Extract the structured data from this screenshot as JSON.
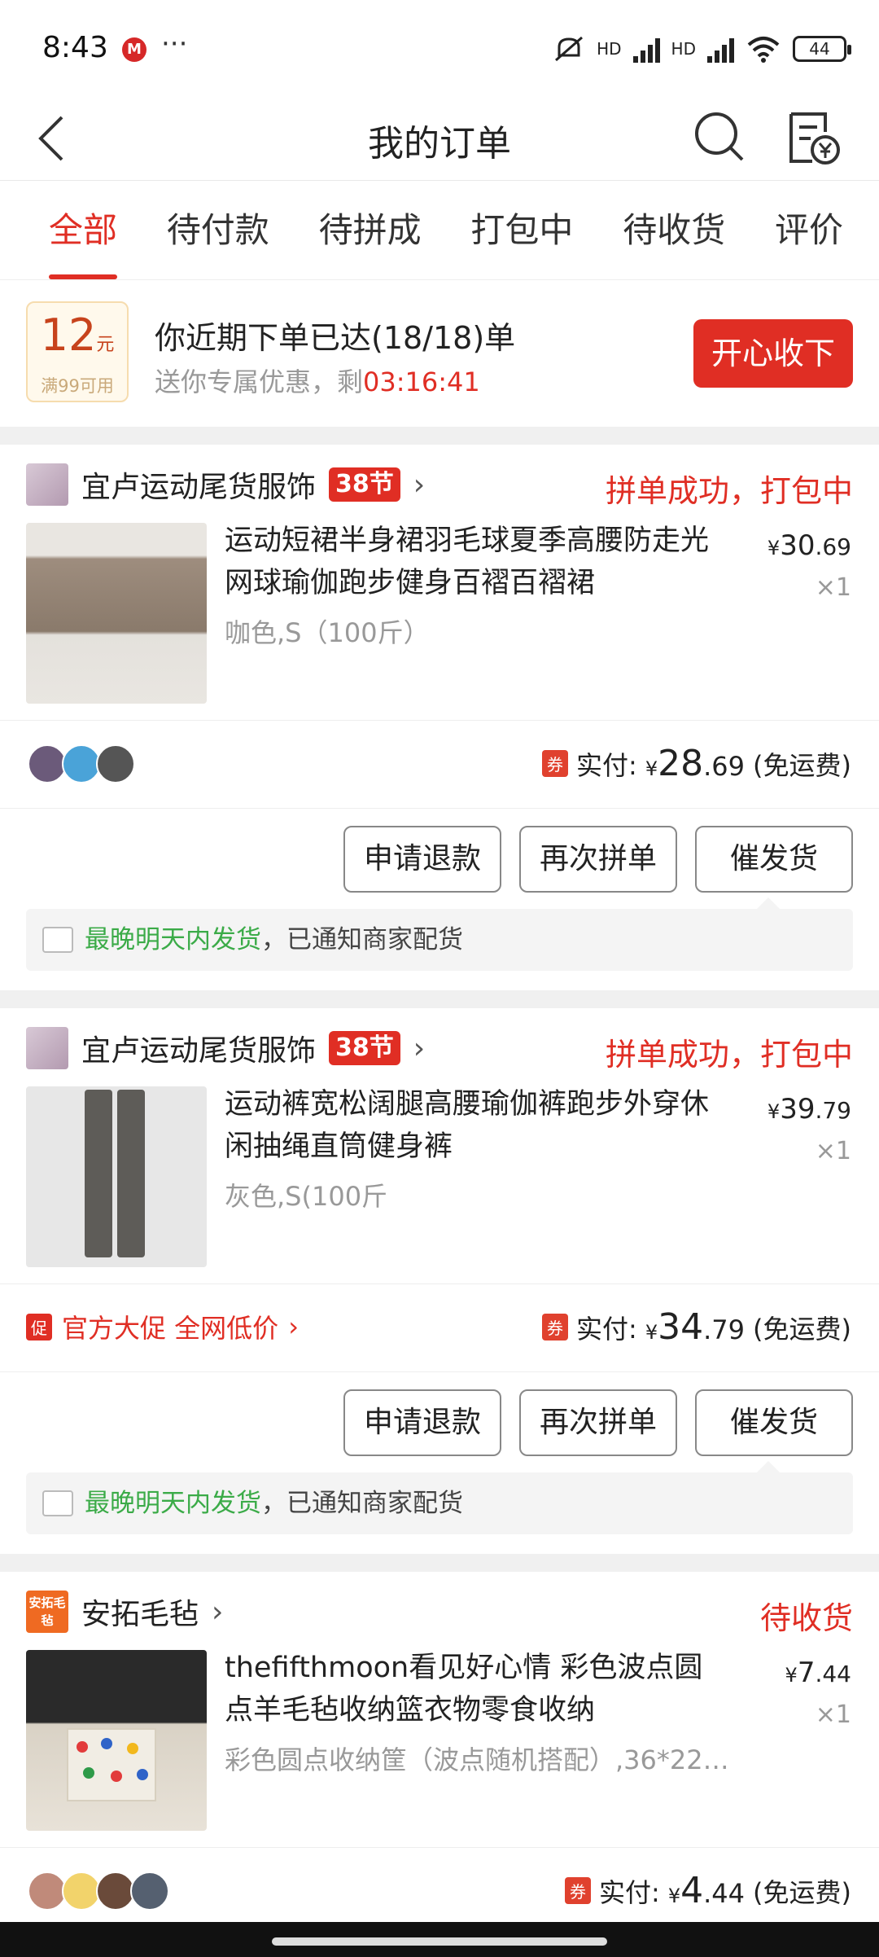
{
  "status_bar": {
    "time": "8:43",
    "battery": "44",
    "network_1": "HD",
    "network_2": "HD"
  },
  "nav": {
    "title": "我的订单"
  },
  "tabs": [
    {
      "label": "全部",
      "active": true
    },
    {
      "label": "待付款",
      "active": false
    },
    {
      "label": "待拼成",
      "active": false
    },
    {
      "label": "打包中",
      "active": false
    },
    {
      "label": "待收货",
      "active": false
    },
    {
      "label": "评价",
      "active": false
    }
  ],
  "promo": {
    "coupon_amount": "12",
    "coupon_unit": "元",
    "coupon_condition": "满99可用",
    "headline": "你近期下单已达(18/18)单",
    "sub_prefix": "送你专属优惠，剩",
    "countdown": "03:16:41",
    "accept_label": "开心收下"
  },
  "orders": [
    {
      "shop_name": "宜卢运动尾货服饰",
      "fest_badge": "38节",
      "status": "拼单成功，打包中",
      "product_title": "运动短裙半身裙羽毛球夏季高腰防走光网球瑜伽跑步健身百褶百褶裙",
      "spec": "咖色,S（100斤）",
      "price_yen": "¥",
      "price_int": "30",
      "price_dec": ".69",
      "qty": "×1",
      "coupon_tag": "券",
      "paid_label": "实付:",
      "paid_yen": "¥",
      "paid_int": "28",
      "paid_dec": ".69",
      "shipping": "(免运费)",
      "buttons": [
        "申请退款",
        "再次拼单",
        "催发货"
      ],
      "notice_green": "最晚明天内发货",
      "notice_rest": "，已通知商家配货"
    },
    {
      "shop_name": "宜卢运动尾货服饰",
      "fest_badge": "38节",
      "status": "拼单成功，打包中",
      "product_title": "运动裤宽松阔腿高腰瑜伽裤跑步外穿休闲抽绳直筒健身裤",
      "spec": "灰色,S(100斤",
      "price_yen": "¥",
      "price_int": "39",
      "price_dec": ".79",
      "qty": "×1",
      "promo_tag": "促",
      "promo_text": "官方大促 全网低价",
      "coupon_tag": "券",
      "paid_label": "实付:",
      "paid_yen": "¥",
      "paid_int": "34",
      "paid_dec": ".79",
      "shipping": "(免运费)",
      "buttons": [
        "申请退款",
        "再次拼单",
        "催发货"
      ],
      "notice_green": "最晚明天内发货",
      "notice_rest": "，已通知商家配货"
    },
    {
      "shop_name": "安拓毛毡",
      "shop_logo_text": "安拓毛毡",
      "status": "待收货",
      "product_title": "thefifthmoon看见好心情 彩色波点圆点羊毛毡收纳篮衣物零食收纳",
      "spec": "彩色圆点收纳筐（波点随机搭配）,36*22…",
      "price_yen": "¥",
      "price_int": "7",
      "price_dec": ".44",
      "qty": "×1",
      "coupon_tag": "券",
      "paid_label": "实付:",
      "paid_yen": "¥",
      "paid_int": "4",
      "paid_dec": ".44",
      "shipping": "(免运费)"
    }
  ],
  "colors": {
    "accent": "#e02e24",
    "notice_green": "#3bab48"
  }
}
